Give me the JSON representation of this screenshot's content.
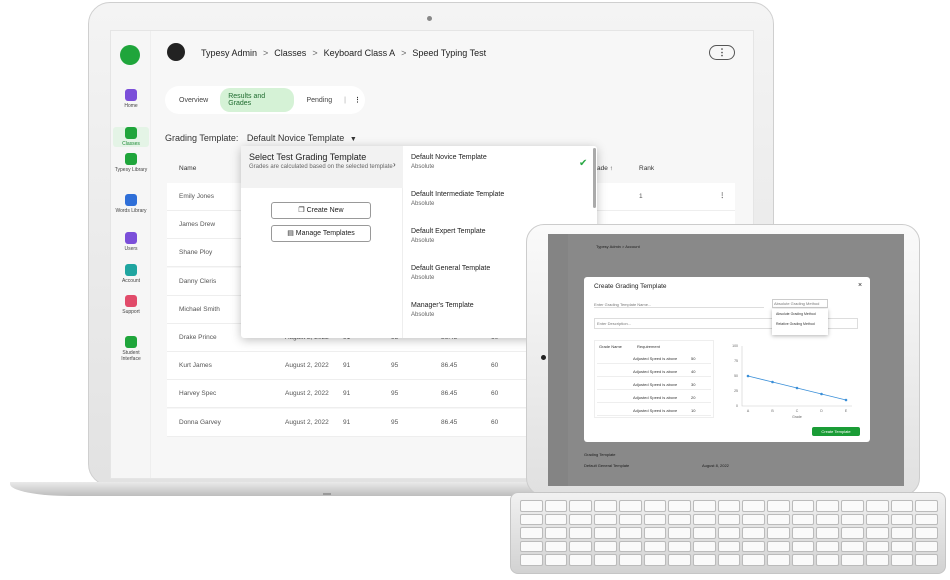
{
  "laptop": {
    "sidebar": [
      {
        "label": "Home",
        "icon": "home-icon",
        "color": "#7b4fd9"
      },
      {
        "label": "Classes",
        "icon": "classes-icon",
        "color": "#1fa53b",
        "active": true
      },
      {
        "label": "Typesy Library",
        "icon": "library-icon",
        "color": "#1fa53b"
      },
      {
        "label": "Words Library",
        "icon": "words-icon",
        "color": "#2f6fd8"
      },
      {
        "label": "Users",
        "icon": "users-icon",
        "color": "#7b4fd9"
      },
      {
        "label": "Account",
        "icon": "account-icon",
        "color": "#1fa5a0"
      },
      {
        "label": "Support",
        "icon": "support-icon",
        "color": "#e14b6a"
      },
      {
        "label": "Student Interface",
        "icon": "student-icon",
        "color": "#1fa53b"
      }
    ],
    "breadcrumb": [
      "Typesy Admin",
      "Classes",
      "Keyboard Class A",
      "Speed Typing Test"
    ],
    "tabs": [
      "Overview",
      "Results and Grades",
      "Pending"
    ],
    "grading_label": "Grading Template:",
    "grading_value": "Default Novice Template",
    "table": {
      "headers": [
        "Name",
        "ade",
        "Rank"
      ],
      "rows": [
        {
          "name": "Emily Jones",
          "date": "",
          "a": "",
          "b": "",
          "c": "",
          "d": "",
          "rank": "1"
        },
        {
          "name": "James Drew",
          "date": "",
          "a": "",
          "b": "",
          "c": "",
          "d": "",
          "rank": ""
        },
        {
          "name": "Shane Ploy",
          "date": "",
          "a": "",
          "b": "",
          "c": "",
          "d": "",
          "rank": ""
        },
        {
          "name": "Danny Cleris",
          "date": "",
          "a": "",
          "b": "",
          "c": "",
          "d": "",
          "rank": ""
        },
        {
          "name": "Michael Smith",
          "date": "",
          "a": "",
          "b": "",
          "c": "",
          "d": "",
          "rank": ""
        },
        {
          "name": "Drake Prince",
          "date": "August 2, 2022",
          "a": "91",
          "b": "95",
          "c": "86.45",
          "d": "60",
          "rank": ""
        },
        {
          "name": "Kurt James",
          "date": "August 2, 2022",
          "a": "91",
          "b": "95",
          "c": "86.45",
          "d": "60",
          "rank": ""
        },
        {
          "name": "Harvey Spec",
          "date": "August 2, 2022",
          "a": "91",
          "b": "95",
          "c": "86.45",
          "d": "60",
          "rank": ""
        },
        {
          "name": "Donna Garvey",
          "date": "August 2, 2022",
          "a": "91",
          "b": "95",
          "c": "86.45",
          "d": "60",
          "rank": ""
        }
      ]
    },
    "dropdown": {
      "title": "Select Test Grading Template",
      "subtitle": "Grades are calculated based on the selected template",
      "create": "Create New",
      "manage": "Manage Templates",
      "options": [
        {
          "name": "Default Novice Template",
          "type": "Absolute",
          "selected": true
        },
        {
          "name": "Default Intermediate Template",
          "type": "Absolute"
        },
        {
          "name": "Default Expert Template",
          "type": "Absolute"
        },
        {
          "name": "Default General Template",
          "type": "Absolute"
        },
        {
          "name": "Manager's Template",
          "type": "Absolute"
        }
      ]
    }
  },
  "tablet": {
    "breadcrumb": [
      "Typesy Admin",
      "Account"
    ],
    "modal": {
      "title": "Create Grading Template",
      "name_placeholder": "Enter Grading Template Name...",
      "desc_placeholder": "Enter Description...",
      "method": "Absolute Grading Method",
      "menu": [
        "Absolute Grading Method",
        "Relative Grading Method"
      ],
      "col_grade": "Grade Name",
      "col_req": "Requirement",
      "rows": [
        {
          "req": "Adjusted Speed is above",
          "val": "50"
        },
        {
          "req": "Adjusted Speed is above",
          "val": "40"
        },
        {
          "req": "Adjusted Speed is above",
          "val": "30"
        },
        {
          "req": "Adjusted Speed is above",
          "val": "20"
        },
        {
          "req": "Adjusted Speed is above",
          "val": "10"
        }
      ],
      "chart_y": [
        "100",
        "75",
        "50",
        "25",
        "0"
      ],
      "chart_x": [
        "A",
        "B",
        "C",
        "D",
        "E"
      ],
      "chart_xlabel": "Grade",
      "button": "Create Template",
      "chart_data": {
        "type": "line",
        "categories": [
          "A",
          "B",
          "C",
          "D",
          "E"
        ],
        "values": [
          50,
          40,
          30,
          20,
          10
        ],
        "ylim": [
          0,
          100
        ]
      }
    },
    "bg_rows": [
      "Grading Template",
      "Default General Template"
    ],
    "bg_date": "August 8, 2022"
  }
}
